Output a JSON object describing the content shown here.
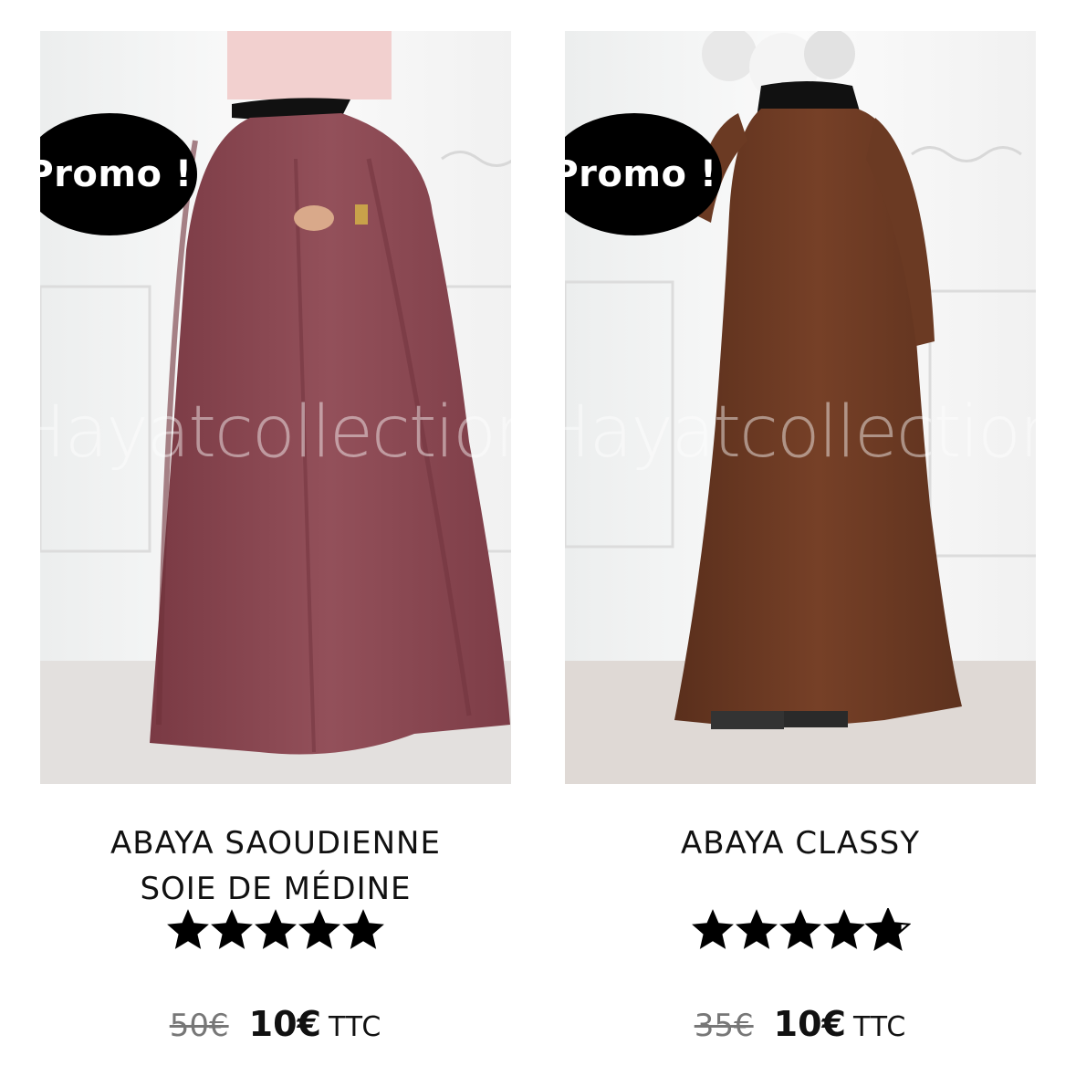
{
  "products": [
    {
      "badge": "Promo !",
      "watermark": "Hayatcollection.fr",
      "title": "ABAYA SAOUDIENNE\nSOIE DE MÉDINE",
      "rating": 5,
      "old_price": "50€",
      "new_price": "10€",
      "tax_label": "TTC",
      "dress_color": "#8a4650"
    },
    {
      "badge": "Promo !",
      "watermark": "Hayatcollection.fr",
      "title": "ABAYA CLASSY",
      "rating": 4.8,
      "old_price": "35€",
      "new_price": "10€",
      "tax_label": "TTC",
      "dress_color": "#6b3a23"
    }
  ]
}
